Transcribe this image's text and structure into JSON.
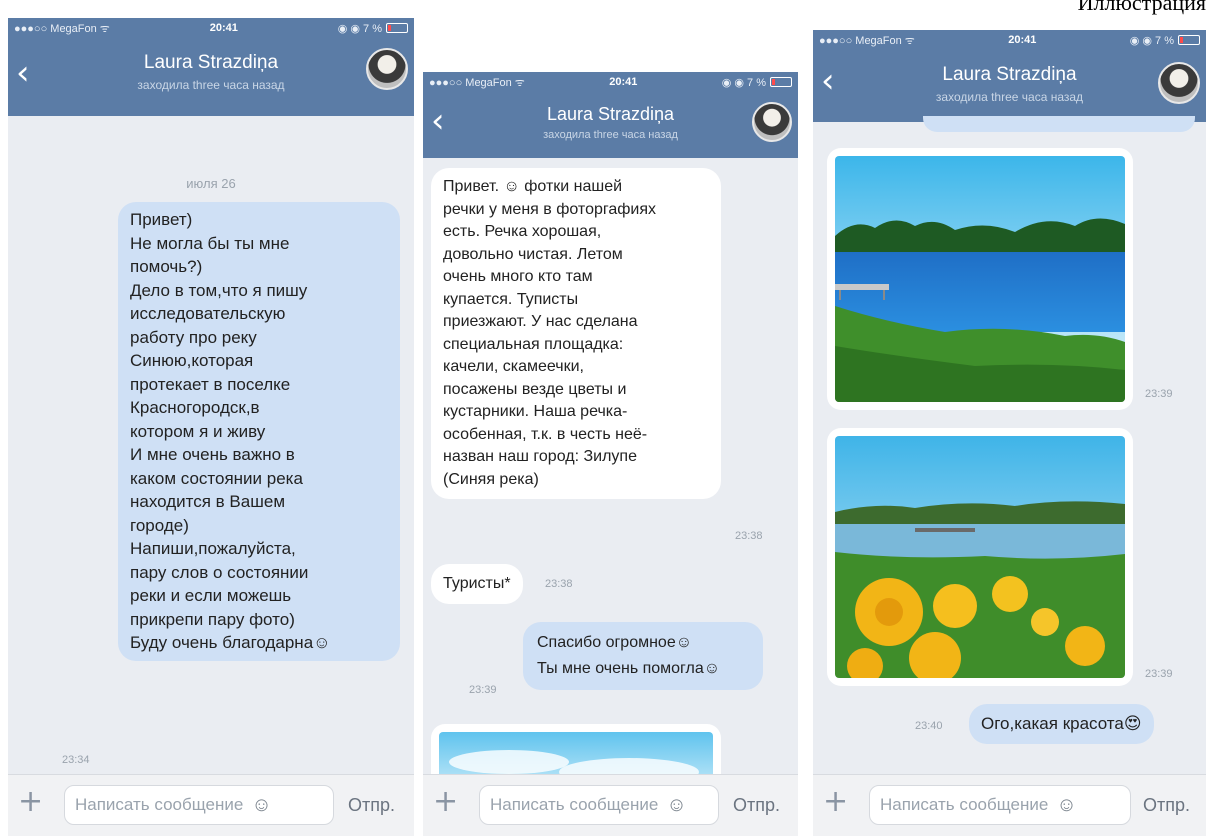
{
  "caption": "Иллюстрация",
  "status": {
    "carrier": "●●●○○ MegaFon ᯤ",
    "time": "20:41",
    "right": "◉ ◉ 7 %"
  },
  "header": {
    "back": "‹",
    "name": "Laura Strazdiņa",
    "last_seen": "заходила three часа назад"
  },
  "input": {
    "plus": "+",
    "placeholder": "Написать сообщение",
    "smile": "☺",
    "send": "Отпр."
  },
  "phone1": {
    "date": "июля 26",
    "message_lines": [
      "Привет)",
      "Не могла бы ты мне",
      "помочь?)",
      "Дело в том,что я пишу",
      "исследовательскую",
      "работу про реку",
      "Синюю,которая",
      "протекает в поселке",
      "Красногородск,в",
      "котором я и живу",
      "И мне очень важно в",
      "каком состоянии река",
      "находится в Вашем",
      "городе)",
      "Напиши,пожалуйста,",
      "пару слов о состоянии",
      "реки и если можешь",
      "прикрепи пару фото)",
      "Буду очень благодарна☺"
    ],
    "time": "23:34"
  },
  "phone2": {
    "reply_lines": [
      "Привет. ☺ фотки нашей",
      "речки у меня в фоторгафиях",
      "есть. Речка хорошая,",
      "довольно чистая. Летом",
      "очень много кто там",
      "купается. Туписты",
      "приезжают. У нас сделана",
      "специальная площадка:",
      "качели, скамеечки,",
      "посажены везде цветы и",
      "кустарники. Наша речка-",
      "особенная, т.к. в честь неё-",
      "назван наш город: Зилупе",
      "(Синяя река)"
    ],
    "reply_time": "23:38",
    "correction": "Туристы*",
    "correction_time": "23:38",
    "thanks_lines": [
      "Спасибо огромное☺",
      "Ты мне очень помогла☺"
    ],
    "thanks_time": "23:39"
  },
  "phone3": {
    "photo1_time": "23:39",
    "photo2_time": "23:39",
    "final_message": "Ого,какая красота😍",
    "final_time": "23:40"
  }
}
